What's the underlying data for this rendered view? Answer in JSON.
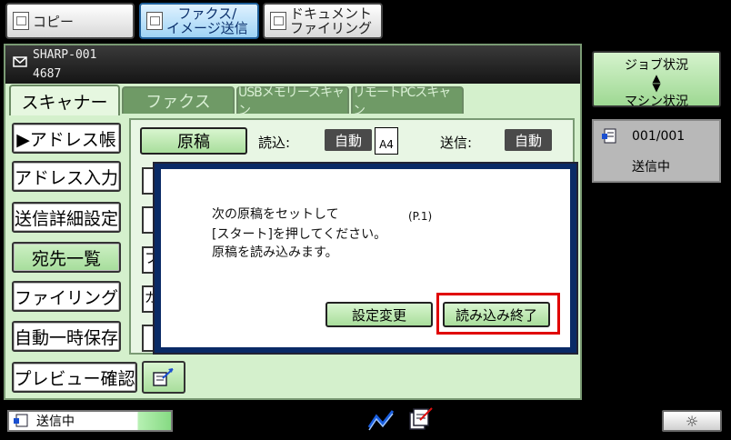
{
  "modes": {
    "copy": "コピー",
    "fax_image_line1": "ファクス/",
    "fax_image_line2": "イメージ送信",
    "doc_filing_line1": "ドキュメント",
    "doc_filing_line2": "ファイリング"
  },
  "header": {
    "device_name": "SHARP-001",
    "device_number": "4687"
  },
  "tabs": [
    {
      "label": "スキャナー",
      "active": true
    },
    {
      "label": "ファクス",
      "active": false
    },
    {
      "label": "USBメモリースキャン",
      "active": false
    },
    {
      "label": "リモートPCスキャン",
      "active": false
    }
  ],
  "sidebar": {
    "address_book": "▶アドレス帳",
    "address_entry": "アドレス入力",
    "send_settings": "送信詳細設定",
    "destination_list": "宛先一覧",
    "filing": "ファイリング",
    "auto_temp_save": "自動一時保存",
    "preview_check": "プレビュー確認"
  },
  "original_row": {
    "original_button": "原稿",
    "read_label": "読込:",
    "read_value": "自動",
    "paper_size": "A4",
    "send_label": "送信:",
    "send_value": "自動"
  },
  "stubs": [
    "フ",
    "ガ"
  ],
  "dialog": {
    "line1": "次の原稿をセットして",
    "page": "(P.1)",
    "line2": "[スタート]を押してください。",
    "line3": "原稿を読み込みます。",
    "settings_button": "設定変更",
    "read_end_button": "読み込み終了"
  },
  "job_status": {
    "title": "ジョブ状況",
    "machine_status": "マシン状況",
    "job_count": "001/001",
    "job_state": "送信中"
  },
  "bottom": {
    "status_text": "送信中"
  },
  "colors": {
    "panel_green": "#d4f0cc",
    "highlight_red": "#e00000",
    "dialog_border": "#0a2a66"
  }
}
